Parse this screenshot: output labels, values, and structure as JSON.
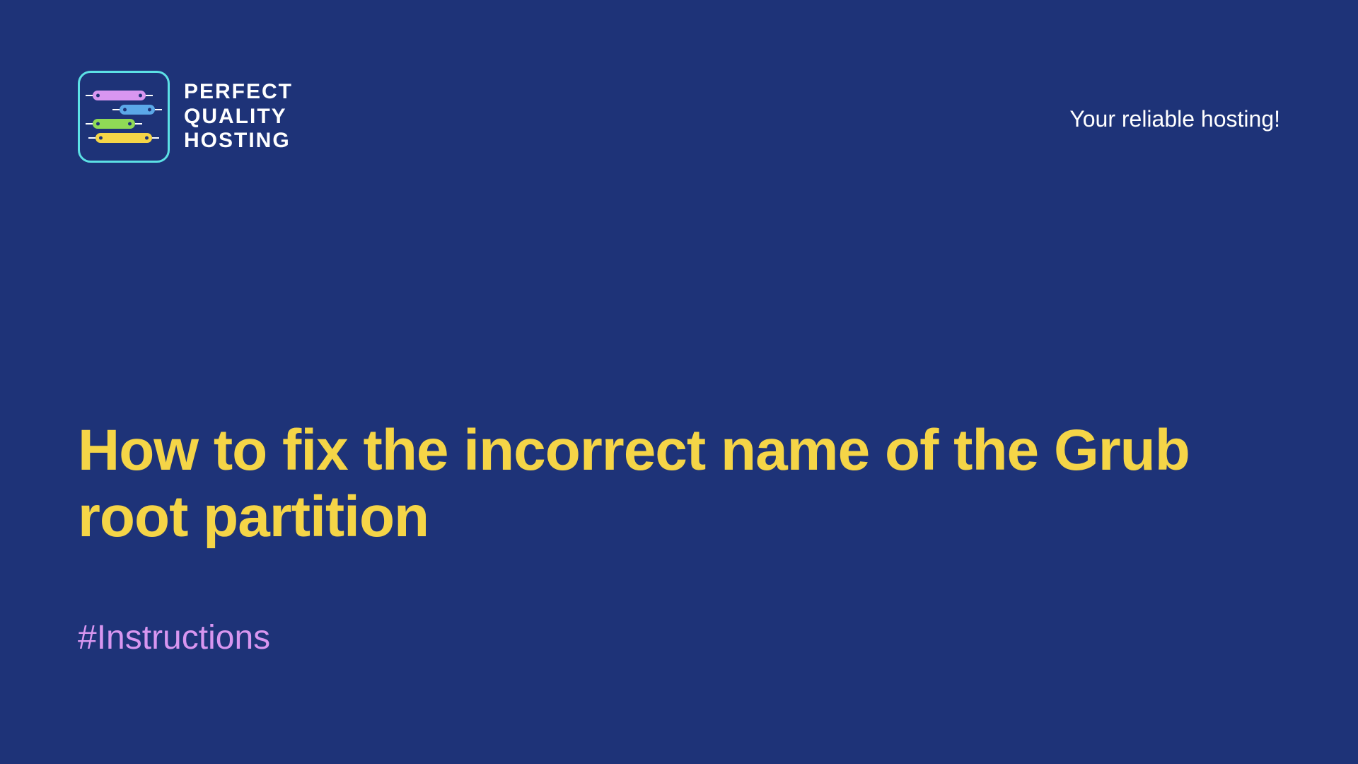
{
  "logo": {
    "line1": "PERFECT",
    "line2": "QUALITY",
    "line3": "HOSTING"
  },
  "tagline": "Your reliable hosting!",
  "title": "How to fix the incorrect name of the Grub root partition",
  "hashtag": "#Instructions"
}
